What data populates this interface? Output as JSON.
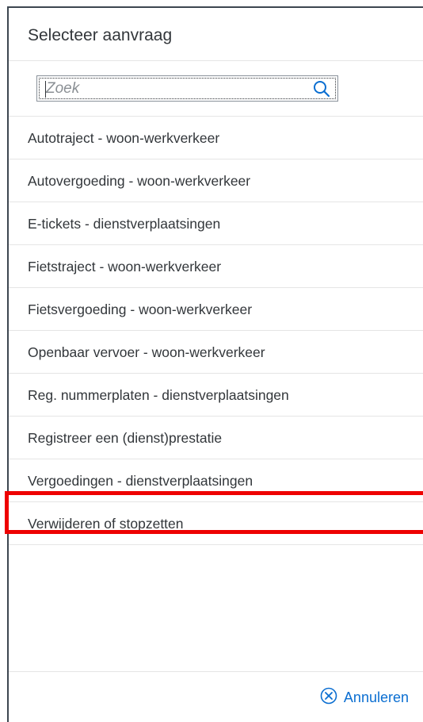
{
  "dialog": {
    "title": "Selecteer aanvraag"
  },
  "search": {
    "placeholder": "Zoek",
    "value": "",
    "icon": "search-icon"
  },
  "items": [
    {
      "label": "Autotraject - woon-werkverkeer"
    },
    {
      "label": "Autovergoeding - woon-werkverkeer"
    },
    {
      "label": "E-tickets - dienstverplaatsingen"
    },
    {
      "label": "Fietstraject - woon-werkverkeer"
    },
    {
      "label": "Fietsvergoeding - woon-werkverkeer"
    },
    {
      "label": "Openbaar vervoer - woon-werkverkeer"
    },
    {
      "label": "Reg. nummerplaten - dienstverplaatsingen"
    },
    {
      "label": "Registreer een (dienst)prestatie"
    },
    {
      "label": "Vergoedingen - dienstverplaatsingen"
    },
    {
      "label": "Verwijderen of stopzetten",
      "highlighted": true
    }
  ],
  "footer": {
    "cancel_label": "Annuleren",
    "cancel_icon": "cancel-circle-icon"
  },
  "colors": {
    "accent": "#0a6ed1",
    "text": "#32363a",
    "highlight": "#ee0000",
    "border": "#3d4650"
  }
}
